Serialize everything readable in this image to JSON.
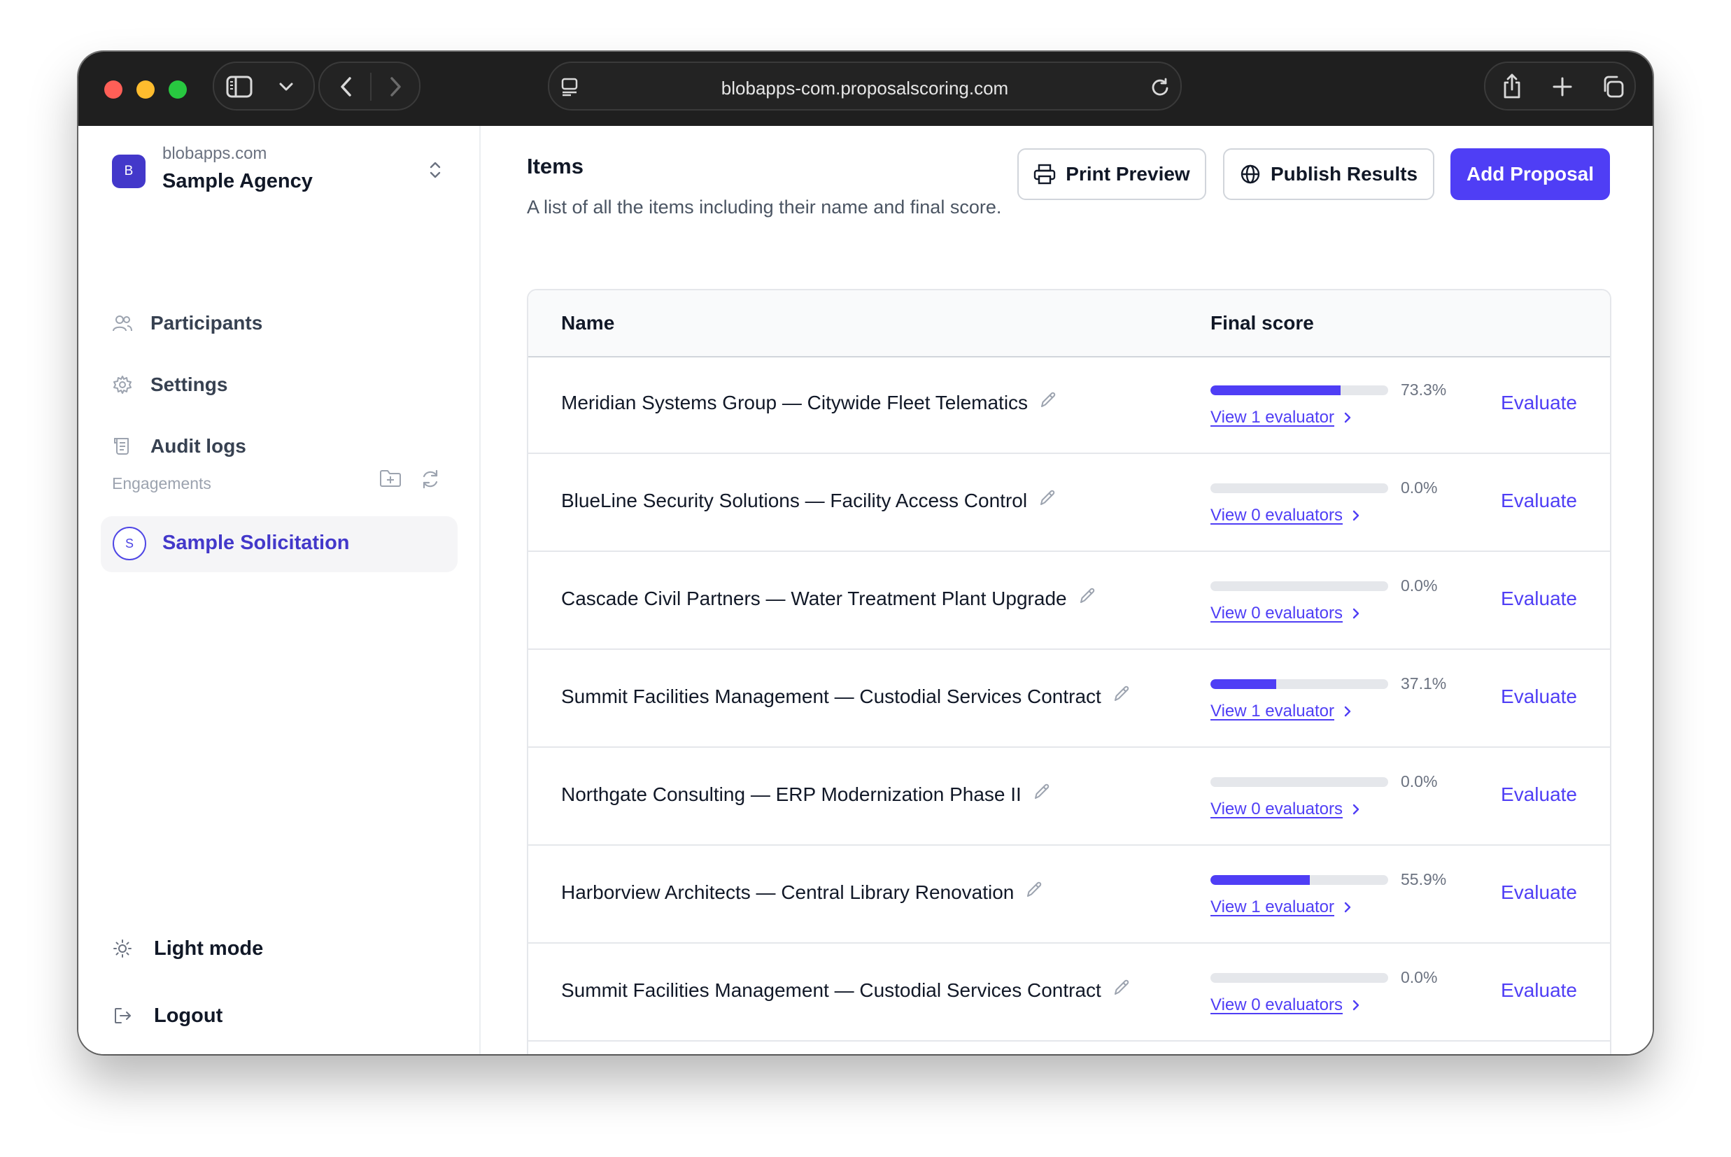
{
  "browser": {
    "url": "blobapps-com.proposalscoring.com"
  },
  "sidebar": {
    "workspace": {
      "initial": "B",
      "domain": "blobapps.com",
      "name": "Sample Agency"
    },
    "nav": [
      {
        "label": "Participants",
        "icon": "users-icon"
      },
      {
        "label": "Settings",
        "icon": "gear-icon"
      },
      {
        "label": "Audit logs",
        "icon": "scroll-icon"
      }
    ],
    "engagements_label": "Engagements",
    "engagement": {
      "initial": "S",
      "label": "Sample Solicitation"
    },
    "footer": {
      "light_mode": "Light mode",
      "logout": "Logout"
    }
  },
  "main": {
    "title": "Items",
    "subtitle": "A list of all the items including their name and final score.",
    "buttons": {
      "print_preview": "Print Preview",
      "publish_results": "Publish Results",
      "add_proposal": "Add Proposal"
    },
    "table": {
      "columns": {
        "name": "Name",
        "final_score": "Final score"
      },
      "rows": [
        {
          "name": "Meridian Systems Group — Citywide Fleet Telematics",
          "score_pct": "73.3%",
          "score": 73.3,
          "view": "View 1 evaluator",
          "action": "Evaluate"
        },
        {
          "name": "BlueLine Security Solutions — Facility Access Control",
          "score_pct": "0.0%",
          "score": 0,
          "view": "View 0 evaluators",
          "action": "Evaluate"
        },
        {
          "name": "Cascade Civil Partners — Water Treatment Plant Upgrade",
          "score_pct": "0.0%",
          "score": 0,
          "view": "View 0 evaluators",
          "action": "Evaluate"
        },
        {
          "name": "Summit Facilities Management — Custodial Services Contract",
          "score_pct": "37.1%",
          "score": 37.1,
          "view": "View 1 evaluator",
          "action": "Evaluate"
        },
        {
          "name": "Northgate Consulting — ERP Modernization Phase II",
          "score_pct": "0.0%",
          "score": 0,
          "view": "View 0 evaluators",
          "action": "Evaluate"
        },
        {
          "name": "Harborview Architects — Central Library Renovation",
          "score_pct": "55.9%",
          "score": 55.9,
          "view": "View 1 evaluator",
          "action": "Evaluate"
        },
        {
          "name": "Summit Facilities Management — Custodial Services Contract",
          "score_pct": "0.0%",
          "score": 0,
          "view": "View 0 evaluators",
          "action": "Evaluate"
        }
      ]
    }
  },
  "colors": {
    "accent": "#4f3ef5",
    "accent_dark": "#4338ca",
    "titlebar": "#1f1f1f"
  }
}
